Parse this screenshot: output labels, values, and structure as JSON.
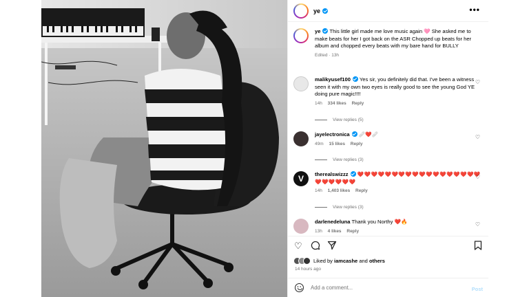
{
  "post": {
    "author": "ye",
    "caption": "This little girl made me love music again 🩷 She asked me to make beats for her I got back on the ASR Chopped up beats for her album and chopped every beats with my bare hand for BULLY",
    "edited": "Edited · 13h"
  },
  "comments": [
    {
      "user": "malikyusef100",
      "text": "Yes sir, you definitely did that. I've been a witness seen it with my own two eyes is really good to see the young God YE doing pure magic!!!!",
      "time": "14h",
      "likes": "334 likes",
      "reply": "Reply",
      "view_replies": "View replies (5)"
    },
    {
      "user": "jayelectronica",
      "text": "🩹❤️🩹",
      "time": "49m",
      "likes": "15 likes",
      "reply": "Reply",
      "view_replies": "View replies (3)"
    },
    {
      "user": "therealswizzz",
      "text": "❤️❤️❤️❤️❤️❤️❤️❤️❤️❤️❤️❤️❤️❤️❤️❤️❤️❤️❤️❤️❤️❤️❤️❤️",
      "time": "14h",
      "likes": "1,403 likes",
      "reply": "Reply",
      "view_replies": "View replies (3)"
    },
    {
      "user": "darlenedeluna",
      "text": "Thank you Northy ❤️🔥",
      "time": "13h",
      "likes": "4 likes",
      "reply": "Reply"
    }
  ],
  "liked_by": {
    "prefix": "Liked by",
    "user": "iamcashe",
    "and": "and",
    "others": "others"
  },
  "timestamp": "14 hours ago",
  "comment_input": {
    "placeholder": "Add a comment..."
  },
  "post_button": "Post",
  "colors": {
    "accent": "#0095f6",
    "heart": "#e0245e",
    "muted": "#737373"
  }
}
